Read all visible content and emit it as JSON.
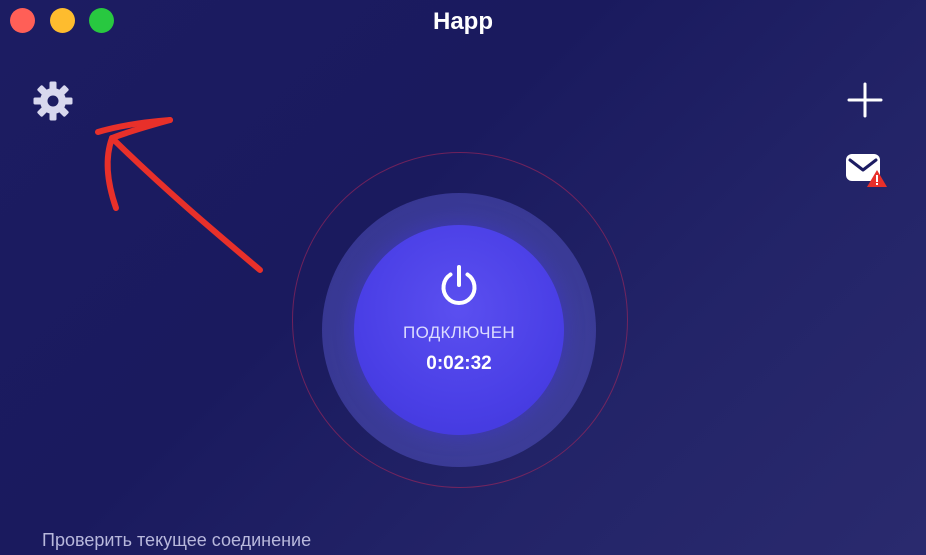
{
  "window": {
    "title": "Happ"
  },
  "toolbar": {
    "settings_icon": "gear-icon",
    "add_icon": "plus-icon",
    "mail_icon": "mail-alert-icon"
  },
  "connection": {
    "status": "ПОДКЛЮЧЕН",
    "elapsed": "0:02:32",
    "power_icon": "power-icon"
  },
  "footer": {
    "check_link": "Проверить текущее соединение"
  },
  "colors": {
    "background": "#1c1c62",
    "button": "#4a3fe6",
    "annotation_arrow": "#e8302a",
    "alert_badge": "#e8302a"
  }
}
